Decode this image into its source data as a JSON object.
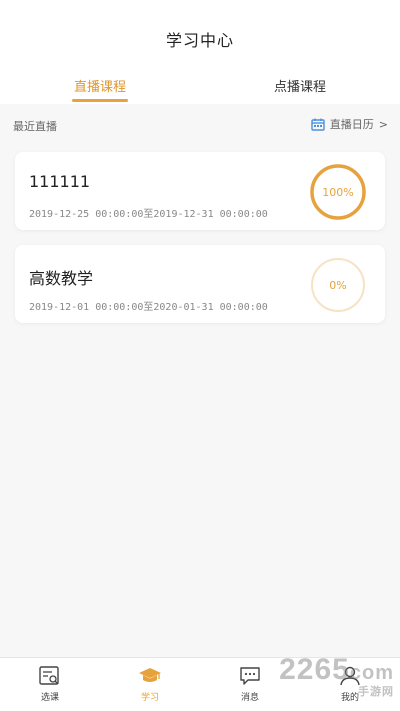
{
  "header": {
    "title": "学习中心"
  },
  "tabs": [
    {
      "label": "直播课程",
      "active": true
    },
    {
      "label": "点播课程",
      "active": false
    }
  ],
  "section": {
    "title": "最近直播",
    "calendar_label": "直播日历",
    "calendar_chevron": ">"
  },
  "courses": [
    {
      "title": "111111",
      "date_range": "2019-12-25 00:00:00至2019-12-31 00:00:00",
      "progress_label": "100%",
      "progress": 1.0
    },
    {
      "title": "高数教学",
      "date_range": "2019-12-01 00:00:00至2020-01-31 00:00:00",
      "progress_label": "0%",
      "progress": 0.0
    }
  ],
  "bottom_nav": [
    {
      "label": "选课",
      "icon": "course-select-icon",
      "active": false
    },
    {
      "label": "学习",
      "icon": "graduation-cap-icon",
      "active": true
    },
    {
      "label": "消息",
      "icon": "message-icon",
      "active": false
    },
    {
      "label": "我的",
      "icon": "user-icon",
      "active": false
    }
  ],
  "watermark": {
    "brand": "2265",
    "suffix": "com",
    "subtitle": "手游网"
  },
  "colors": {
    "accent": "#e6a23c",
    "ring_light": "#f6e3c4",
    "background": "#f7f7f7"
  }
}
